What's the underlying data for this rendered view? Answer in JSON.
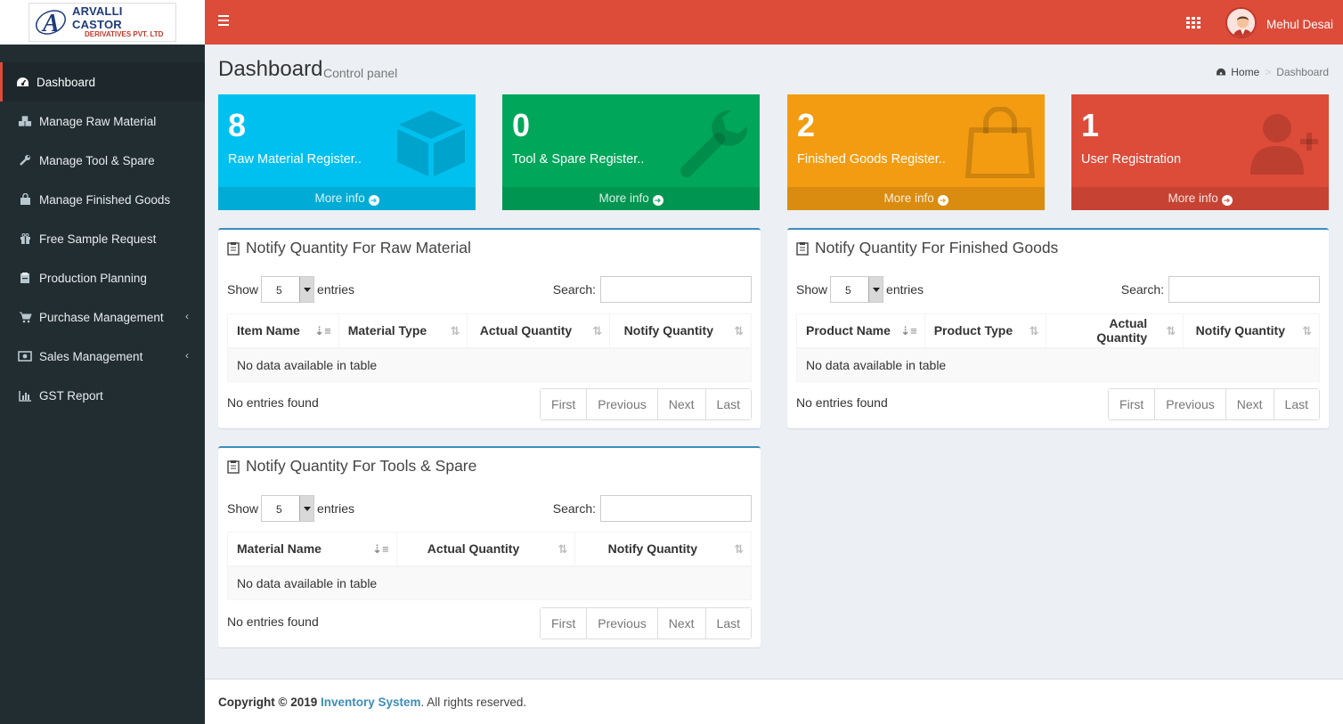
{
  "brand": {
    "line1": "ARVALLI CASTOR",
    "line2": "DERIVATIVES PVT. LTD",
    "primary_color": "#dd4b39",
    "sidebar_color": "#222d32"
  },
  "header": {
    "user_name": "Mehul Desai"
  },
  "sidebar": {
    "items": [
      {
        "label": "Dashboard",
        "icon": "dashboard-icon",
        "active": true
      },
      {
        "label": "Manage Raw Material",
        "icon": "cubes-icon"
      },
      {
        "label": "Manage Tool & Spare",
        "icon": "wrench-icon"
      },
      {
        "label": "Manage Finished Goods",
        "icon": "shopping-bag-icon"
      },
      {
        "label": "Free Sample Request",
        "icon": "gift-icon"
      },
      {
        "label": "Production Planning",
        "icon": "clipboard-icon"
      },
      {
        "label": "Purchase Management",
        "icon": "cart-icon",
        "caret": "‹"
      },
      {
        "label": "Sales Management",
        "icon": "money-icon",
        "caret": "‹"
      },
      {
        "label": "GST Report",
        "icon": "bar-chart-icon"
      }
    ]
  },
  "page": {
    "title": "Dashboard",
    "subtitle": "Control panel",
    "breadcrumb_home": "Home",
    "breadcrumb_current": "Dashboard"
  },
  "boxes": [
    {
      "count": "8",
      "label": "Raw Material Register..",
      "more": "More info",
      "color": "#00c0ef",
      "icon": "cube-icon"
    },
    {
      "count": "0",
      "label": "Tool & Spare Register..",
      "more": "More info",
      "color": "#00a65a",
      "icon": "wrench-icon"
    },
    {
      "count": "2",
      "label": "Finished Goods Register..",
      "more": "More info",
      "color": "#f39c12",
      "icon": "shopping-bag-icon"
    },
    {
      "count": "1",
      "label": "User Registration",
      "more": "More info",
      "color": "#dd4b39",
      "icon": "user-plus-icon"
    }
  ],
  "common": {
    "show": "Show",
    "entries": "entries",
    "page_size": "5",
    "search": "Search:",
    "empty": "No data available in table",
    "no_entries": "No entries found",
    "first": "First",
    "previous": "Previous",
    "next": "Next",
    "last": "Last"
  },
  "panels": {
    "raw": {
      "title": "Notify Quantity For Raw Material",
      "columns": [
        "Item Name",
        "Material Type",
        "Actual Quantity",
        "Notify Quantity"
      ]
    },
    "finished": {
      "title": "Notify Quantity For Finished Goods",
      "columns": [
        "Product Name",
        "Product Type",
        "Actual Quantity",
        "Notify Quantity"
      ]
    },
    "tools": {
      "title": "Notify Quantity For Tools & Spare",
      "columns": [
        "Material Name",
        "Actual Quantity",
        "Notify Quantity"
      ]
    }
  },
  "footer": {
    "prefix": "Copyright © 2019",
    "brand": "Inventory System",
    "suffix": ". All rights reserved."
  }
}
